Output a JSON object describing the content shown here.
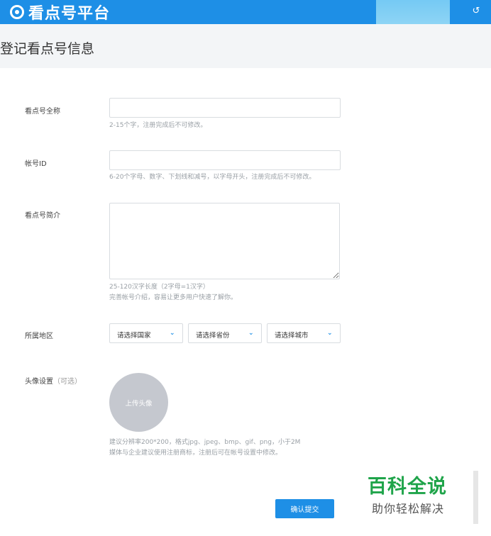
{
  "header": {
    "logo_text": "看点号平台",
    "logo_icon": "kandian-eye-icon",
    "logout_icon": "logout-icon"
  },
  "page": {
    "title": "登记看点号信息"
  },
  "form": {
    "full_name": {
      "label": "看点号全称",
      "value": "",
      "hint": "2-15个字，注册完成后不可修改。"
    },
    "account_id": {
      "label": "帐号ID",
      "value": "",
      "hint": "6-20个字母、数字、下划线和减号，以字母开头，注册完成后不可修改。"
    },
    "intro": {
      "label": "看点号简介",
      "value": "",
      "hint_1": "25-120汉字长度（2字母=1汉字）",
      "hint_2": "完善帐号介绍，容易让更多用户快速了解你。"
    },
    "region": {
      "label": "所属地区",
      "country": "请选择国家",
      "province": "请选择省份",
      "city": "请选择城市"
    },
    "avatar": {
      "label": "头像设置",
      "optional": "（可选）",
      "upload_label": "上传头像",
      "hint_1": "建议分辨率200*200，格式jpg、jpeg、bmp、gif、png，小于2M",
      "hint_2": "媒体与企业建议使用注册商标，注册后可在帐号设置中修改。"
    },
    "submit_label": "确认提交"
  },
  "watermark": {
    "line1": "百科全说",
    "line2": "助你轻松解决"
  },
  "colors": {
    "primary": "#1e8fe6",
    "watermark_green": "#1fa44a"
  }
}
